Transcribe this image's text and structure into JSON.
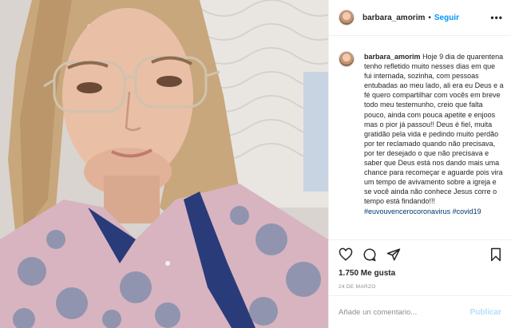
{
  "post": {
    "username": "barbara_amorim",
    "separator": "•",
    "follow_label": "Seguir",
    "more_label": "•••",
    "caption_user": "barbara_amorim",
    "caption_text": "Hoje 9 dia de quarentena tenho refletido muito nesses dias em que fui internada, sozinha, com pessoas entubadas ao meu lado, ali era eu Deus e a fé quero compartilhar com vocês em breve todo meu testemunho, creio que falta pouco, ainda com pouca apetite e enjoos mas o pior já passou!! Deus é fiel, muita gratidão pela vida e pedindo muito perdão por ter reclamado quando não precisava, por ter desejado o que não precisava e saber que Deus está nos dando mais uma chance para recomeçar e aguarde pois vira um tempo de avivamento sobre a igreja e se você ainda não conhece Jesus corre o tempo está findando!!!",
    "hashtags": "#euvouvencerocoronavirus #covid19",
    "likes": "1.750 Me gusta",
    "date": "24 DE MARZO",
    "comment_placeholder": "Añade un comentario...",
    "publish_label": "Publicar"
  },
  "icons": {
    "like": "heart-icon",
    "comment": "comment-icon",
    "share": "share-icon",
    "save": "bookmark-icon",
    "avatar": "avatar"
  },
  "colors": {
    "link": "#0095f6",
    "publish_disabled": "#b2dffc",
    "hashtag": "#00376b",
    "muted": "#8e8e8e"
  }
}
